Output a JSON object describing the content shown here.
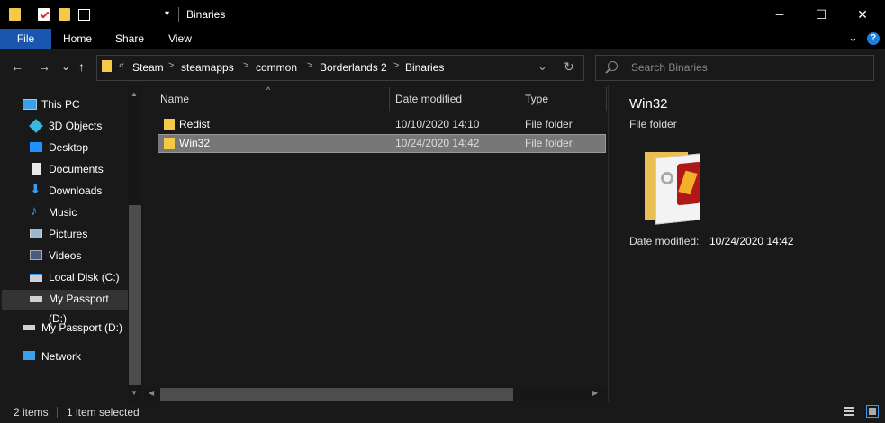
{
  "window": {
    "title": "Binaries",
    "min_glyph": "─",
    "max_glyph": "☐",
    "close_glyph": "✕"
  },
  "ribbon": {
    "tabs": [
      "File",
      "Home",
      "Share",
      "View"
    ],
    "expand_glyph": "⌄",
    "help_glyph": "?"
  },
  "nav": {
    "back_glyph": "←",
    "forward_glyph": "→",
    "recent_glyph": "⌄",
    "up_glyph": "↑",
    "overflow_glyph": "«",
    "breadcrumb": [
      "Steam",
      "steamapps",
      "common",
      "Borderlands 2",
      "Binaries"
    ],
    "sep_glyph": ">",
    "dropdown_glyph": "⌄",
    "refresh_glyph": "↻",
    "search_placeholder": "Search Binaries"
  },
  "sidebar": {
    "items": [
      {
        "label": "This PC",
        "icon": "pc-icon"
      },
      {
        "label": "3D Objects",
        "icon": "3d-objects-icon"
      },
      {
        "label": "Desktop",
        "icon": "desktop-icon"
      },
      {
        "label": "Documents",
        "icon": "documents-icon"
      },
      {
        "label": "Downloads",
        "icon": "downloads-icon"
      },
      {
        "label": "Music",
        "icon": "music-icon"
      },
      {
        "label": "Pictures",
        "icon": "pictures-icon"
      },
      {
        "label": "Videos",
        "icon": "videos-icon"
      },
      {
        "label": "Local Disk (C:)",
        "icon": "local-disk-icon"
      },
      {
        "label": "My Passport (D:)",
        "icon": "drive-icon"
      },
      {
        "label": "My Passport (D:)",
        "icon": "drive-icon"
      },
      {
        "label": "Network",
        "icon": "network-icon"
      }
    ]
  },
  "filelist": {
    "sort_glyph": "^",
    "columns": [
      "Name",
      "Date modified",
      "Type"
    ],
    "rows": [
      {
        "name": "Redist",
        "date": "10/10/2020 14:10",
        "type": "File folder"
      },
      {
        "name": "Win32",
        "date": "10/24/2020 14:42",
        "type": "File folder"
      }
    ]
  },
  "details": {
    "name": "Win32",
    "type": "File folder",
    "date_label": "Date modified:",
    "date_value": "10/24/2020 14:42"
  },
  "status": {
    "count": "2 items",
    "selected": "1 item selected"
  },
  "colors": {
    "accent": "#1a56b0",
    "folder": "#f3c948",
    "selection": "#777777"
  }
}
